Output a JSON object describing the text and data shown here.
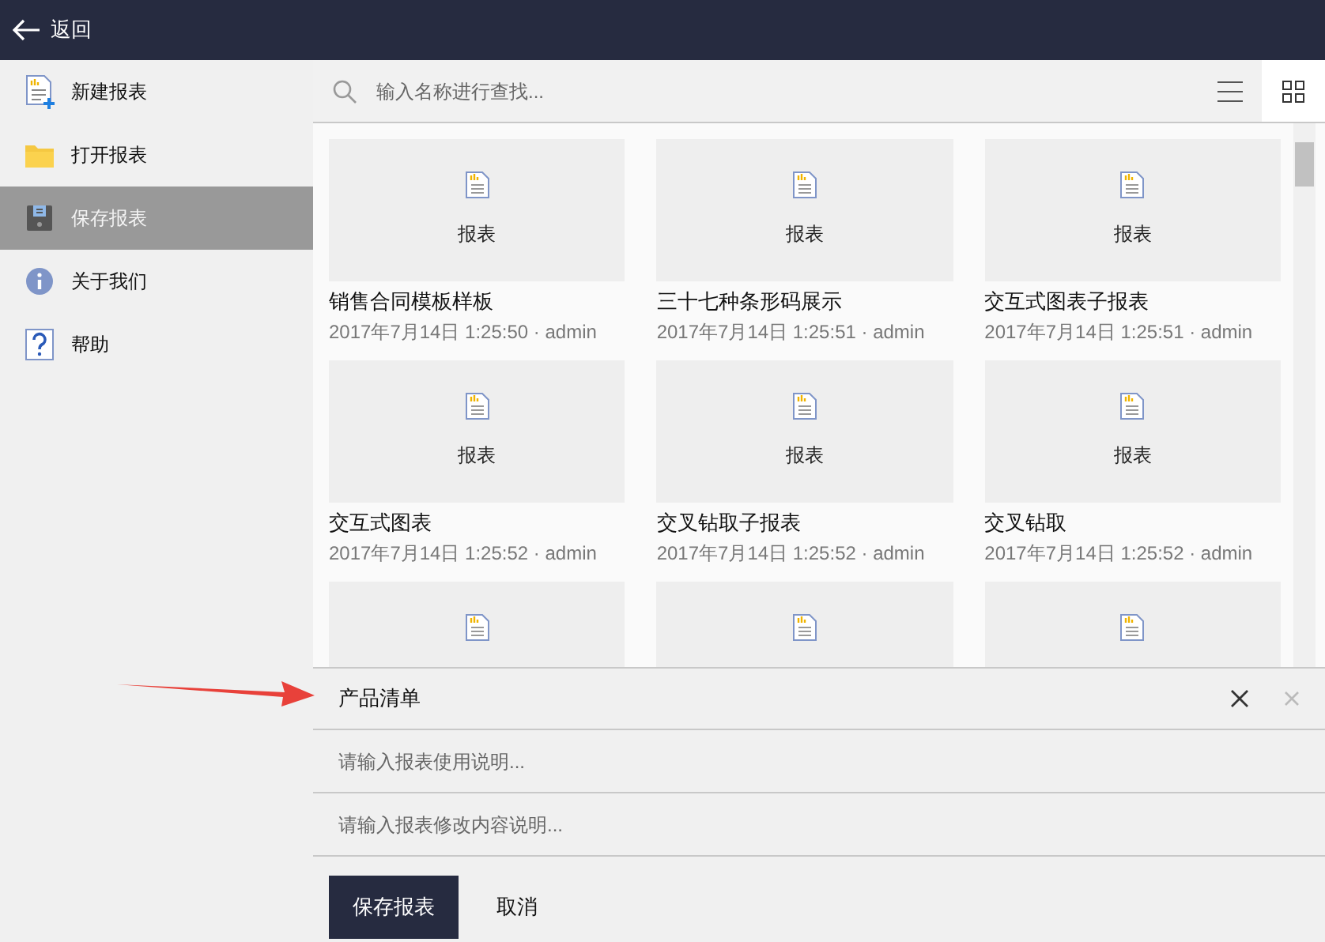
{
  "top_bar": {
    "back_label": "返回"
  },
  "sidebar": {
    "items": [
      {
        "label": "新建报表",
        "kind": "new",
        "selected": false
      },
      {
        "label": "打开报表",
        "kind": "folder",
        "selected": false
      },
      {
        "label": "保存报表",
        "kind": "save",
        "selected": true
      },
      {
        "label": "关于我们",
        "kind": "info",
        "selected": false
      },
      {
        "label": "帮助",
        "kind": "help",
        "selected": false
      }
    ]
  },
  "search": {
    "placeholder": "输入名称进行查找..."
  },
  "view_toggle": [
    {
      "kind": "list",
      "selected": false
    },
    {
      "kind": "grid",
      "selected": true
    }
  ],
  "cards": [
    {
      "kind": "full",
      "thumb_label": "报表",
      "title": "销售合同模板样板",
      "meta": "2017年7月14日 1:25:50 · admin"
    },
    {
      "kind": "full",
      "thumb_label": "报表",
      "title": "三十七种条形码展示",
      "meta": "2017年7月14日 1:25:51 · admin"
    },
    {
      "kind": "full",
      "thumb_label": "报表",
      "title": "交互式图表子报表",
      "meta": "2017年7月14日 1:25:51 · admin"
    },
    {
      "kind": "full",
      "thumb_label": "报表",
      "title": "交互式图表",
      "meta": "2017年7月14日 1:25:52 · admin"
    },
    {
      "kind": "full",
      "thumb_label": "报表",
      "title": "交叉钻取子报表",
      "meta": "2017年7月14日 1:25:52 · admin"
    },
    {
      "kind": "full",
      "thumb_label": "报表",
      "title": "交叉钻取",
      "meta": "2017年7月14日 1:25:52 · admin"
    },
    {
      "kind": "cut"
    },
    {
      "kind": "cut"
    },
    {
      "kind": "cut"
    }
  ],
  "form": {
    "name_value": "产品清单",
    "usage_placeholder": "请输入报表使用说明...",
    "change_placeholder": "请输入报表修改内容说明..."
  },
  "buttons": [
    {
      "label": "保存报表",
      "kind": "primary"
    },
    {
      "label": "取消",
      "kind": "plain"
    }
  ]
}
